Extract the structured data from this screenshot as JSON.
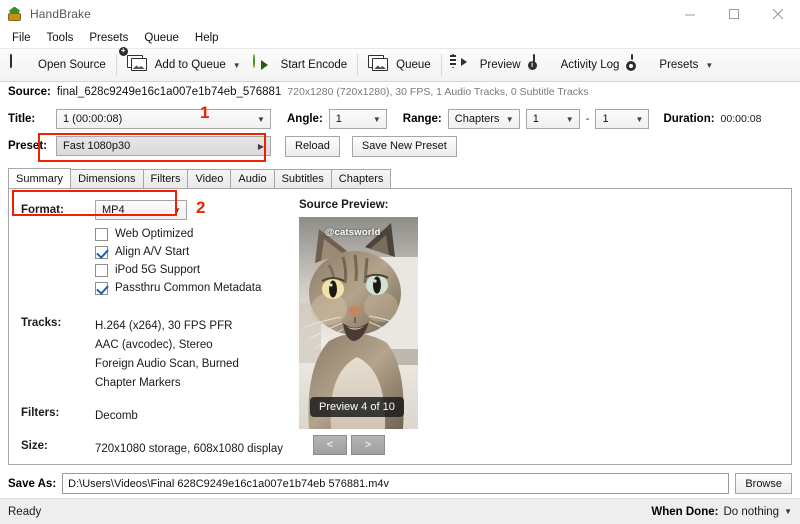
{
  "window": {
    "title": "HandBrake",
    "minimize_label": "Minimize",
    "maximize_label": "Maximize",
    "close_label": "Close"
  },
  "menubar": {
    "items": [
      "File",
      "Tools",
      "Presets",
      "Queue",
      "Help"
    ]
  },
  "toolbar": {
    "items": [
      {
        "label": "Open Source",
        "icon": "film-icon",
        "caret": false
      },
      {
        "label": "Add to Queue",
        "icon": "add-picture-icon",
        "caret": true
      },
      {
        "label": "Start Encode",
        "icon": "play-icon",
        "caret": false
      },
      {
        "label": "Queue",
        "icon": "queue-icon",
        "caret": false
      },
      {
        "label": "Preview",
        "icon": "preview-monitor-icon",
        "caret": false
      },
      {
        "label": "Activity Log",
        "icon": "activity-log-icon",
        "caret": false
      },
      {
        "label": "Presets",
        "icon": "presets-gear-icon",
        "caret": true
      }
    ]
  },
  "source": {
    "label": "Source:",
    "filename": "final_628c9249e16c1a007e1b74eb_576881",
    "meta": "720x1280 (720x1280), 30 FPS, 1 Audio Tracks, 0 Subtitle Tracks"
  },
  "title_row": {
    "label": "Title:",
    "value": "1  (00:00:08)",
    "angle_label": "Angle:",
    "angle_value": "1",
    "range_label": "Range:",
    "range_value": "Chapters",
    "range_from": "1",
    "range_dash": "-",
    "range_to": "1",
    "duration_label": "Duration:",
    "duration_value": "00:00:08"
  },
  "preset_row": {
    "label": "Preset:",
    "value": "Fast 1080p30",
    "reload_label": "Reload",
    "save_new_label": "Save New Preset"
  },
  "tabs": [
    {
      "label": "Summary",
      "active": true
    },
    {
      "label": "Dimensions",
      "active": false
    },
    {
      "label": "Filters",
      "active": false
    },
    {
      "label": "Video",
      "active": false
    },
    {
      "label": "Audio",
      "active": false
    },
    {
      "label": "Subtitles",
      "active": false
    },
    {
      "label": "Chapters",
      "active": false
    }
  ],
  "summary": {
    "format_label": "Format:",
    "format_value": "MP4",
    "checkboxes": [
      {
        "label": "Web Optimized",
        "checked": false
      },
      {
        "label": "Align A/V Start",
        "checked": true
      },
      {
        "label": "iPod 5G Support",
        "checked": false
      },
      {
        "label": "Passthru Common Metadata",
        "checked": true
      }
    ],
    "tracks_label": "Tracks:",
    "tracks": [
      "H.264 (x264), 30 FPS PFR",
      "AAC (avcodec), Stereo",
      "Foreign Audio Scan, Burned",
      "Chapter Markers"
    ],
    "filters_label": "Filters:",
    "filters_value": "Decomb",
    "size_label": "Size:",
    "size_value": "720x1080 storage, 608x1080 display"
  },
  "preview": {
    "title": "Source Preview:",
    "watermark": "@catsworld",
    "badge": "Preview 4 of 10",
    "prev_label": "<",
    "next_label": ">"
  },
  "save_as": {
    "label": "Save As:",
    "path": "D:\\Users\\Videos\\Final 628C9249e16c1a007e1b74eb 576881.m4v",
    "browse_label": "Browse"
  },
  "statusbar": {
    "status": "Ready",
    "when_done_label": "When Done:",
    "when_done_value": "Do nothing"
  },
  "annotations": {
    "marker_1": "1",
    "marker_2": "2",
    "color": "#ee2200"
  }
}
